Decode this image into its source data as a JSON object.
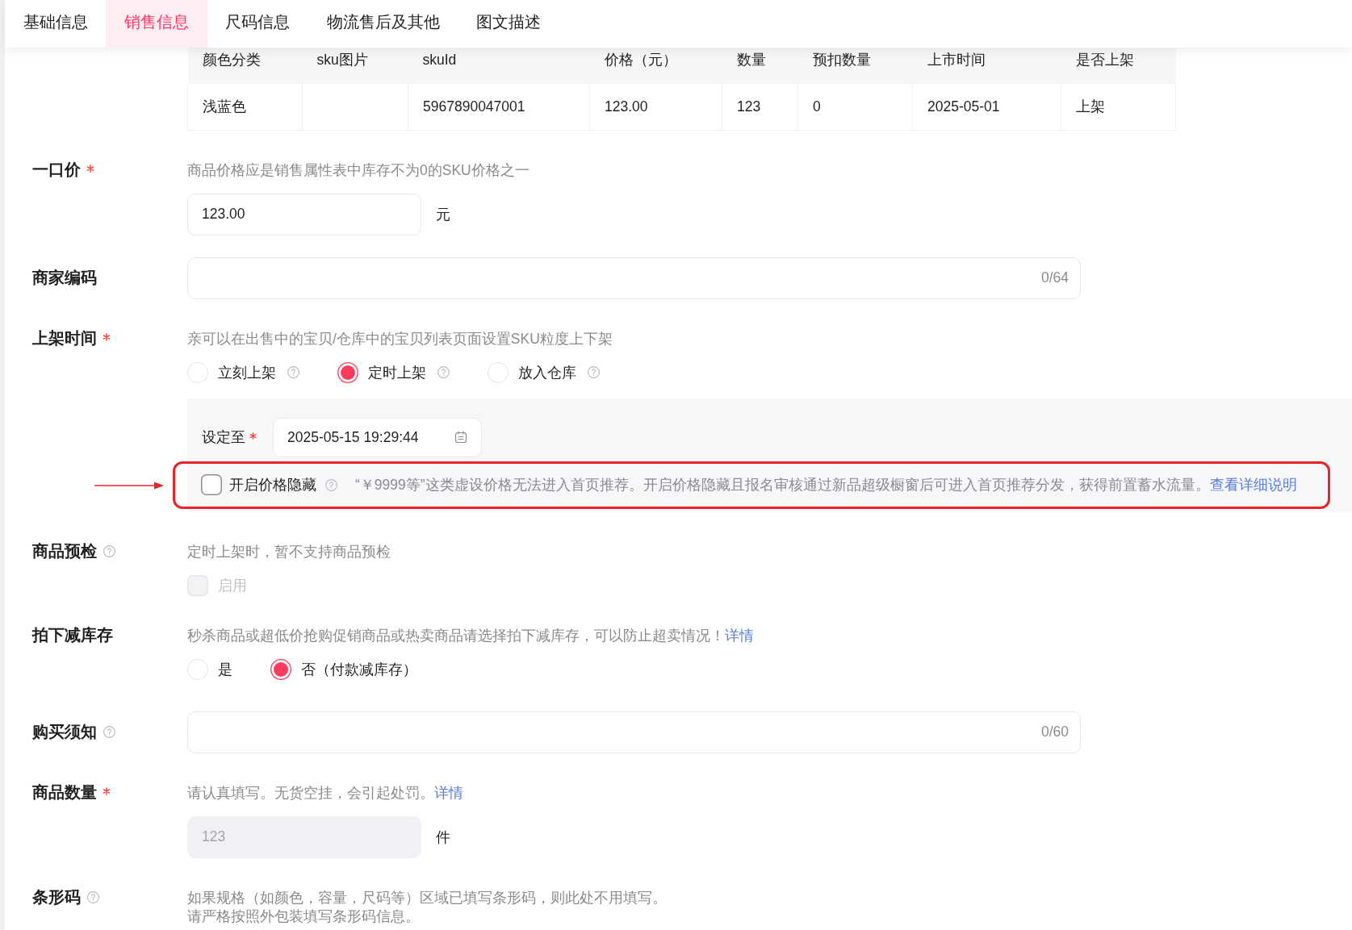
{
  "tabs": [
    {
      "label": "基础信息",
      "selected": false
    },
    {
      "label": "销售信息",
      "selected": true
    },
    {
      "label": "尺码信息",
      "selected": false
    },
    {
      "label": "物流售后及其他",
      "selected": false
    },
    {
      "label": "图文描述",
      "selected": false
    }
  ],
  "sku_table": {
    "columns": [
      "颜色分类",
      "sku图片",
      "skuId",
      "价格（元）",
      "数量",
      "预扣数量",
      "上市时间",
      "是否上架"
    ],
    "rows": [
      [
        "浅蓝色",
        null,
        "5967890047001",
        "123.00",
        "123",
        "0",
        "2025-05-01",
        "上架"
      ]
    ]
  },
  "fields": [
    {
      "label": "一口价",
      "required": true,
      "help": false,
      "hint": "商品价格应是销售属性表中库存不为0的SKU价格之一",
      "control": {
        "kind": "number",
        "value": "123.00",
        "unit": "元",
        "disabled": false
      }
    },
    {
      "label": "商家编码",
      "required": false,
      "help": false,
      "control": {
        "kind": "text",
        "counter": "0/64"
      }
    },
    {
      "label": "上架时间",
      "required": true,
      "help": false,
      "hint": "亲可以在出售中的宝贝/仓库中的宝贝列表页面设置SKU粒度上下架",
      "control": {
        "kind": "radio",
        "options": [
          {
            "label": "立刻上架",
            "selected": false,
            "help": true
          },
          {
            "label": "定时上架",
            "selected": true,
            "help": true
          },
          {
            "label": "放入仓库",
            "selected": false,
            "help": true
          }
        ]
      },
      "schedule": {
        "label": "设定至",
        "required": true,
        "value": "2025-05-15 19:29:44",
        "price_hiding": {
          "label": "开启价格隐藏",
          "checked": false,
          "help": true,
          "hint": "“￥9999等”这类虚设价格无法进入首页推荐。开启价格隐藏且报名审核通过新品超级橱窗后可进入首页推荐分发，获得前置蓄水流量。",
          "link": "查看详细说明",
          "highlighted": true
        }
      }
    },
    {
      "label": "商品预检",
      "required": false,
      "help": true,
      "hint": "定时上架时，暂不支持商品预检",
      "control": {
        "kind": "checkbox",
        "label": "启用",
        "checked": false,
        "disabled": true
      }
    },
    {
      "label": "拍下减库存",
      "required": false,
      "help": false,
      "hint": "秒杀商品或超低价抢购促销商品或热卖商品请选择拍下减库存，可以防止超卖情况！",
      "link": "详情",
      "control": {
        "kind": "radio",
        "options": [
          {
            "label": "是",
            "selected": false,
            "help": false
          },
          {
            "label": "否（付款减库存）",
            "selected": true,
            "help": false
          }
        ]
      }
    },
    {
      "label": "购买须知",
      "required": false,
      "help": true,
      "control": {
        "kind": "text",
        "counter": "0/60"
      }
    },
    {
      "label": "商品数量",
      "required": true,
      "help": false,
      "hint": "请认真填写。无货空挂，会引起处罚。",
      "link": "详情",
      "control": {
        "kind": "number",
        "value": "123",
        "unit": "件",
        "disabled": true
      }
    },
    {
      "label": "条形码",
      "required": false,
      "help": true,
      "hint": [
        "如果规格（如颜色，容量，尺码等）区域已填写条形码，则此处不用填写。",
        "请严格按照外包装填写条形码信息。"
      ]
    }
  ]
}
